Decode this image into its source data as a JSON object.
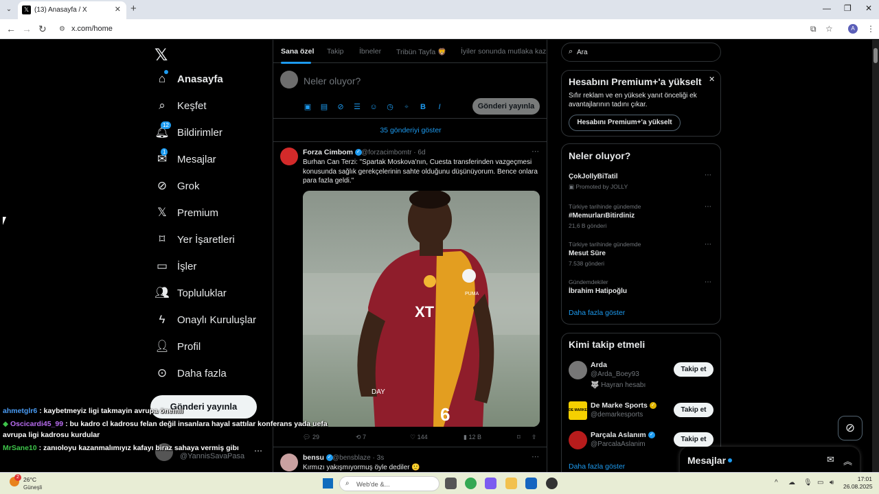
{
  "browser": {
    "tab_title": "(13) Anasayfa / X",
    "url": "x.com/home",
    "profile_initial": "A"
  },
  "nav": {
    "items": [
      {
        "label": "Anasayfa",
        "icon": "home-icon"
      },
      {
        "label": "Keşfet",
        "icon": "search-icon"
      },
      {
        "label": "Bildirimler",
        "icon": "bell-icon",
        "badge": "12"
      },
      {
        "label": "Mesajlar",
        "icon": "mail-icon",
        "badge": "1"
      },
      {
        "label": "Grok",
        "icon": "grok-icon"
      },
      {
        "label": "Premium",
        "icon": "x-premium-icon"
      },
      {
        "label": "Yer İşaretleri",
        "icon": "bookmark-icon"
      },
      {
        "label": "İşler",
        "icon": "briefcase-icon"
      },
      {
        "label": "Topluluklar",
        "icon": "people-icon"
      },
      {
        "label": "Onaylı Kuruluşlar",
        "icon": "lightning-icon"
      },
      {
        "label": "Profil",
        "icon": "person-icon"
      },
      {
        "label": "Daha fazla",
        "icon": "more-circle-icon"
      }
    ],
    "post_button": "Gönderi yayınla",
    "account_handle": "@YannisSavaPasa"
  },
  "feed": {
    "tabs": [
      "Sana özel",
      "Takip",
      "İbneler",
      "Tribün Tayfa 🦁",
      "İyiler sonunda mutlaka kaz"
    ],
    "compose_placeholder": "Neler oluyor?",
    "compose_post": "Gönderi yayınla",
    "show_more": "35 gönderiyi göster",
    "tweet": {
      "name": "Forza Cimbom",
      "handle": "@forzacimbomtr",
      "time": "6d",
      "text": "Burhan Can Terzi: \"Spartak Moskova'nın, Cuesta transferinden vazgeçmesi konusunda sağlık gerekçelerinin sahte olduğunu düşünüyorum. Bence onlara para fazla geldi.\"",
      "replies": "29",
      "reposts": "7",
      "likes": "144",
      "views": "12 B",
      "jersey_number": "6",
      "jersey_sponsor": "XT",
      "jersey_brand": "PUMA",
      "jersey_partner": "DAY"
    },
    "tweet2": {
      "name": "bensu",
      "handle": "@bensblaze",
      "time": "3s",
      "text": "Kırmızı yakışmıyormuş öyle dediler 🙂"
    }
  },
  "sidebar": {
    "search_placeholder": "Ara",
    "premium": {
      "title": "Hesabını Premium+'a yükselt",
      "desc": "Sıfır reklam ve en yüksek yanıt önceliği ek avantajlarının tadını çıkar.",
      "button": "Hesabını Premium+'a yükselt"
    },
    "trends": {
      "title": "Neler oluyor?",
      "items": [
        {
          "name": "ÇokJollyBiTatil",
          "sub": "Promoted by JOLLY"
        },
        {
          "context": "Türkiye tarihinde gündemde",
          "name": "#MemurlarıBitirdiniz",
          "sub": "21,6 B gönderi"
        },
        {
          "context": "Türkiye tarihinde gündemde",
          "name": "Mesut Süre",
          "sub": "7.538 gönderi"
        },
        {
          "context": "Gündemdekiler",
          "name": "İbrahim Hatipoğlu",
          "sub": ""
        }
      ],
      "more": "Daha fazla göster"
    },
    "who_to_follow": {
      "title": "Kimi takip etmeli",
      "items": [
        {
          "name": "Arda",
          "handle": "@Arda_Boey93",
          "extra": "🐺 Hayran hesabı",
          "button": "Takip et"
        },
        {
          "name": "De Marke Sports",
          "handle": "@demarkesports",
          "button": "Takip et",
          "avatar_text": "DE MARKE"
        },
        {
          "name": "Parçala Aslanım",
          "handle": "@ParcalaAslanim",
          "button": "Takip et"
        }
      ],
      "more": "Daha fazla göster"
    }
  },
  "messages_dock": {
    "title": "Mesajlar"
  },
  "chat": [
    {
      "user": "ahmetglr6",
      "color": "#4a9cf5",
      "text": ": kaybetmeyiz ligi takmayin avrupa önemli"
    },
    {
      "user": "Oscicardi45_99",
      "color": "#b86cf0",
      "prefix": "◆",
      "text": ": bu kadro cl kadrosu felan değil insanlara hayal sattılar konferans yada uefa"
    },
    {
      "user": "",
      "color": "#ffffff",
      "text": "avrupa ligi kadrosu kurdular"
    },
    {
      "user": "MrSane10",
      "color": "#3ec44a",
      "text": ": zanıoloyu kazanmalımıyız kafayı biraz sahaya vermiş gibı"
    }
  ],
  "taskbar": {
    "weather_temp": "26°C",
    "weather_desc": "Güneşli",
    "weather_badge": "2",
    "search_placeholder": "Web'de &...",
    "time": "17:01",
    "date": "26.08.2025"
  },
  "colors": {
    "accent": "#1d9bf0",
    "background": "#000000",
    "border": "#2f3336",
    "muted": "#71767b"
  }
}
